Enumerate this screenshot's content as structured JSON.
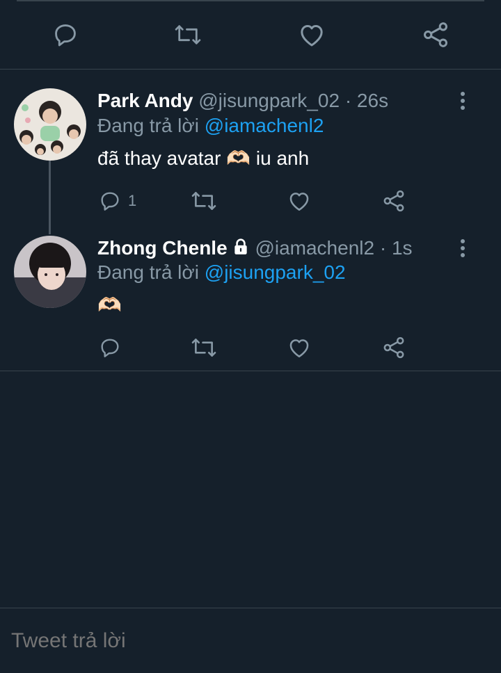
{
  "top_actions": {
    "icons": [
      "reply-icon",
      "retweet-icon",
      "like-icon",
      "share-icon"
    ]
  },
  "tweets": [
    {
      "name": "Park Andy",
      "handle": "@jisungpark_02",
      "separator": "·",
      "time": "26s",
      "reply_prefix": "Đang trả lời",
      "reply_to": "@iamachenl2",
      "text": "đã thay avatar 🫶🏻 iu anh",
      "reply_count": "1",
      "locked": false
    },
    {
      "name": "Zhong Chenle",
      "handle": "@iamachenl2",
      "separator": "·",
      "time": "1s",
      "reply_prefix": "Đang trả lời",
      "reply_to": "@jisungpark_02",
      "text": "🫶🏻",
      "reply_count": "",
      "locked": true
    }
  ],
  "compose": {
    "placeholder": "Tweet trả lời"
  },
  "colors": {
    "background": "#15202b",
    "divider": "#38444d",
    "secondary_text": "#8899a6",
    "accent": "#1da1f2"
  }
}
